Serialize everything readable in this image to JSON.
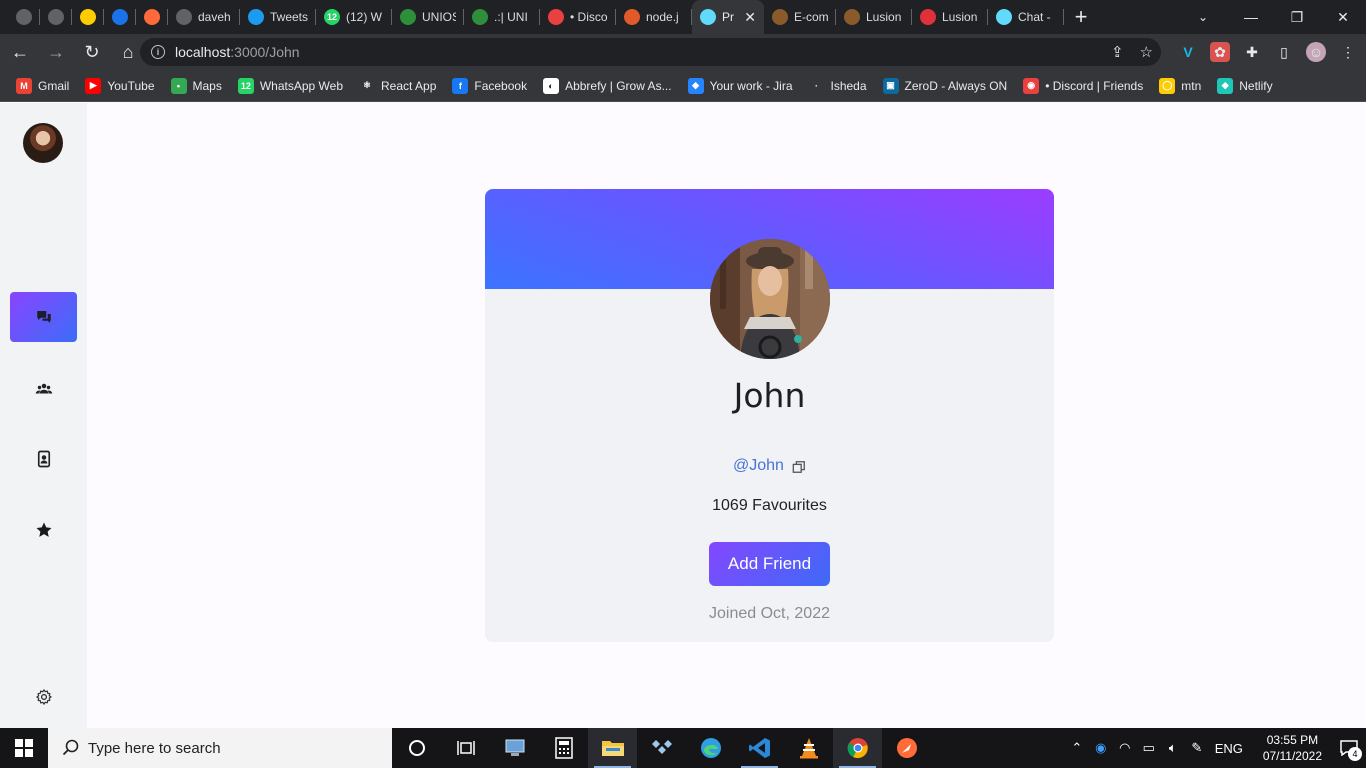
{
  "browser": {
    "tabs": [
      {
        "title": "",
        "color": "#5f6368"
      },
      {
        "title": "",
        "color": "#5f6368"
      },
      {
        "title": "",
        "color": "#ffcc00"
      },
      {
        "title": "",
        "color": "#1a73e8"
      },
      {
        "title": "",
        "color": "#ff6a3d"
      },
      {
        "title": "daveh",
        "color": "#5f6368"
      },
      {
        "title": "Tweets",
        "color": "#1d9bf0"
      },
      {
        "title": "(12) W",
        "color": "#25d366",
        "badge": "12"
      },
      {
        "title": "UNIOS",
        "color": "#2d8f3a"
      },
      {
        "title": ".:| UNI",
        "color": "#2d8f3a"
      },
      {
        "title": "• Disco",
        "color": "#e94040"
      },
      {
        "title": "node.j",
        "color": "#e05a2a"
      },
      {
        "title": "Pro",
        "color": "#61dafb",
        "active": true
      },
      {
        "title": "E-com",
        "color": "#8a5a2b"
      },
      {
        "title": "Lusion",
        "color": "#8a5a2b"
      },
      {
        "title": "Lusion",
        "color": "#e0303a"
      },
      {
        "title": "Chat -",
        "color": "#61dafb"
      }
    ],
    "url_host": "localhost",
    "url_rest": ":3000/John",
    "bookmarks": [
      {
        "label": "Gmail",
        "color": "#ea4335",
        "glyph": "M"
      },
      {
        "label": "YouTube",
        "color": "#ff0000",
        "glyph": "▶"
      },
      {
        "label": "Maps",
        "color": "#34a853",
        "glyph": "•"
      },
      {
        "label": "WhatsApp Web",
        "color": "#25d366",
        "glyph": "12"
      },
      {
        "label": "React App",
        "color": "#35363a",
        "glyph": "⚛"
      },
      {
        "label": "Facebook",
        "color": "#1877f2",
        "glyph": "f"
      },
      {
        "label": "Abbrefy | Grow As...",
        "color": "#ffffff",
        "glyph": "◐"
      },
      {
        "label": "Your work - Jira",
        "color": "#2684ff",
        "glyph": "◆"
      },
      {
        "label": "Isheda",
        "color": "#35363a",
        "glyph": "·"
      },
      {
        "label": "ZeroD - Always ON",
        "color": "#0b6aa0",
        "glyph": "▣"
      },
      {
        "label": "• Discord | Friends",
        "color": "#e94040",
        "glyph": "◉"
      },
      {
        "label": "mtn",
        "color": "#ffcc00",
        "glyph": "◯"
      },
      {
        "label": "Netlify",
        "color": "#20c6b7",
        "glyph": "◆"
      }
    ]
  },
  "profile": {
    "name": "John",
    "handle": "@John",
    "favourites": "1069 Favourites",
    "add_friend_label": "Add Friend",
    "joined": "Joined Oct, 2022"
  },
  "taskbar": {
    "search_placeholder": "Type here to search",
    "language": "ENG",
    "time": "03:55 PM",
    "date": "07/11/2022",
    "notifications": "4"
  },
  "colors": {
    "accent_start": "#8a44ff",
    "accent_end": "#3b6df8",
    "handle": "#4a72d8"
  }
}
